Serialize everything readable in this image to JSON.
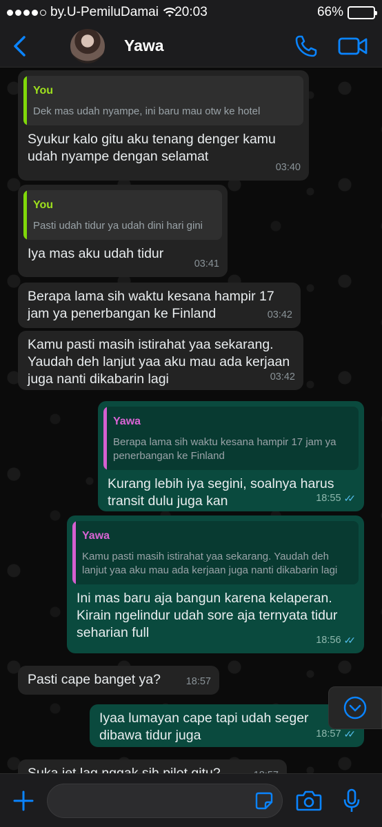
{
  "status_bar": {
    "carrier": "by.U-PemiluDamai",
    "time": "20:03",
    "battery": "66%",
    "battery_level": 0.66
  },
  "header": {
    "contact_name": "Yawa",
    "icons": [
      "back-chevron-icon",
      "phone-icon",
      "video-call-icon"
    ]
  },
  "messages": [
    {
      "direction": "in",
      "quote": {
        "author": "You",
        "text": "Dek mas udah nyampe, ini baru mau otw ke hotel"
      },
      "text": "Syukur kalo gitu aku tenang denger kamu udah nyampe dengan selamat",
      "time": "03:40"
    },
    {
      "direction": "in",
      "quote": {
        "author": "You",
        "text": "Pasti udah tidur ya udah dini hari gini"
      },
      "text": "Iya mas aku udah tidur",
      "time": "03:41"
    },
    {
      "direction": "in",
      "text": "Berapa lama sih waktu kesana hampir 17 jam ya penerbangan ke Finland",
      "time": "03:42"
    },
    {
      "direction": "in",
      "text": "Kamu pasti masih istirahat yaa sekarang. Yaudah deh lanjut yaa aku mau ada kerjaan juga nanti dikabarin lagi",
      "time": "03:42"
    },
    {
      "direction": "out",
      "quote": {
        "author": "Yawa",
        "text": "Berapa lama sih waktu kesana hampir 17 jam ya penerbangan ke Finland"
      },
      "text": "Kurang lebih iya segini, soalnya harus transit dulu juga kan",
      "time": "18:55"
    },
    {
      "direction": "out",
      "quote": {
        "author": "Yawa",
        "text": "Kamu pasti masih istirahat yaa sekarang. Yaudah deh lanjut yaa aku mau ada kerjaan juga nanti dikabarin lagi"
      },
      "text": "Ini mas baru aja bangun karena kelaperan. Kirain ngelindur udah sore aja ternyata tidur seharian full",
      "time": "18:56"
    },
    {
      "direction": "in",
      "text": "Pasti cape banget ya?",
      "time": "18:57"
    },
    {
      "direction": "out",
      "text": "Iyaa lumayan cape tapi udah seger dibawa tidur juga",
      "time": "18:57"
    },
    {
      "direction": "in",
      "text": "Suka jet lag nggak sih pilot gitu?",
      "time": "18:57"
    }
  ],
  "input_bar": {
    "placeholder": "",
    "icons": [
      "plus-icon",
      "sticker-icon",
      "camera-icon",
      "microphone-icon"
    ]
  },
  "colors": {
    "incoming_bubble": "#232323",
    "outgoing_bubble": "#0a4a3e",
    "accent_blue": "#0a84ff",
    "you_quote": "#80d80a",
    "yawa_quote": "#d55fd0",
    "read_ticks": "#53bdeb"
  }
}
